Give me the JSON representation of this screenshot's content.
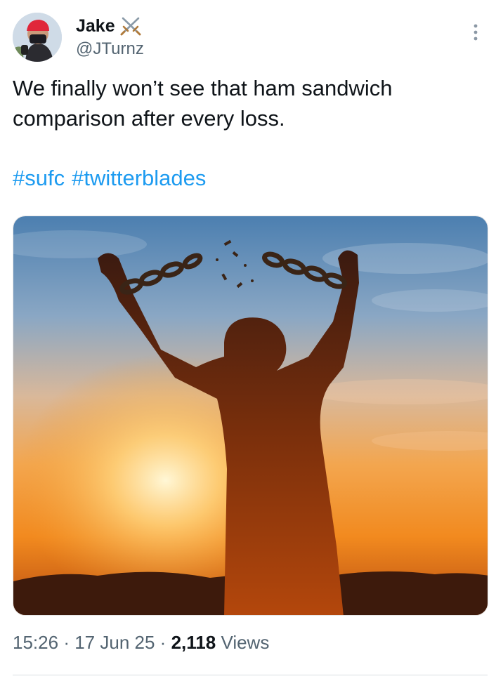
{
  "author": {
    "display_name": "Jake",
    "handle": "@JTurnz",
    "badge_icon": "crossed-swords-icon"
  },
  "tweet": {
    "text": "We finally won’t see that ham sandwich comparison after every loss.",
    "hashtags": [
      "#sufc",
      "#twitterblades"
    ],
    "media_description_icon": "man-breaking-chains-sunset-photo"
  },
  "meta": {
    "time": "15:26",
    "separator": "·",
    "date": "17 Jun 25",
    "views_count": "2,118",
    "views_label": "Views"
  },
  "colors": {
    "link": "#1d9bf0",
    "secondary_text": "#536471",
    "primary_text": "#0f1419"
  }
}
